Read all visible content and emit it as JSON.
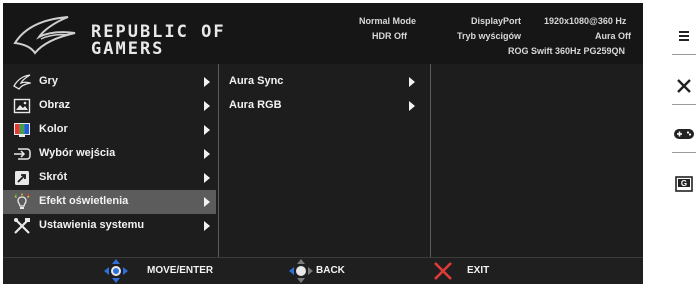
{
  "header": {
    "logo_text_line1": "REPUBLIC OF",
    "logo_text_line2": "GAMERS",
    "mode": "Normal Mode",
    "hdr": "HDR Off",
    "input": "DisplayPort",
    "racing": "Tryb wyścigów",
    "resolution": "1920x1080@360 Hz",
    "aura": "Aura Off",
    "model": "ROG Swift 360Hz PG259QN"
  },
  "menu": {
    "items": [
      {
        "label": "Gry",
        "icon": "gamepad-claw-icon"
      },
      {
        "label": "Obraz",
        "icon": "image-icon"
      },
      {
        "label": "Kolor",
        "icon": "color-icon"
      },
      {
        "label": "Wybór wejścia",
        "icon": "input-icon"
      },
      {
        "label": "Skrót",
        "icon": "shortcut-icon"
      },
      {
        "label": "Efekt oświetlenia",
        "icon": "lighting-icon"
      },
      {
        "label": "Ustawienia systemu",
        "icon": "system-tools-icon"
      }
    ],
    "selected_index": 5,
    "submenu": [
      {
        "label": "Aura Sync"
      },
      {
        "label": "Aura RGB"
      }
    ]
  },
  "footer": {
    "move_enter": "MOVE/ENTER",
    "back": "BACK",
    "exit": "EXIT"
  },
  "side_panel": {
    "icons": [
      "menu-icon",
      "close-icon",
      "gamepad-icon",
      "gameplus-icon"
    ],
    "gameplus_letter": "G"
  },
  "colors": {
    "background": "#161616",
    "menu_bg": "#1d1d1d",
    "selected_row": "#5c5c5c",
    "text": "#f2f2f2",
    "nav_blue": "#2f6fd8",
    "exit_red": "#e23a3a"
  }
}
